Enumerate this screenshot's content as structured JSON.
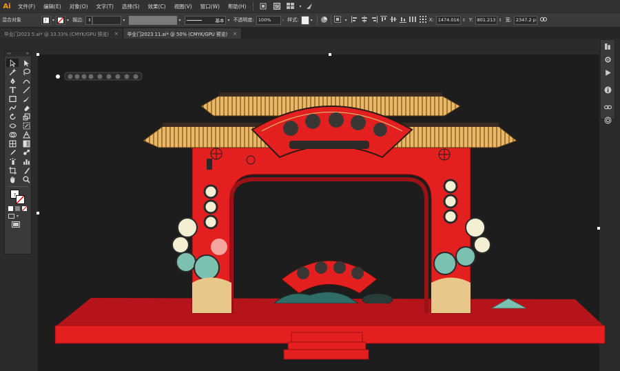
{
  "app": {
    "logo": "Ai"
  },
  "menu": [
    "文件(F)",
    "编辑(E)",
    "对象(O)",
    "文字(T)",
    "选择(S)",
    "效果(C)",
    "视图(V)",
    "窗口(W)",
    "帮助(H)"
  ],
  "control": {
    "selection_label": "混合对象",
    "stroke_label": "描边:",
    "stroke_style": "基本",
    "opacity_label": "不透明度:",
    "opacity_value": "100%",
    "style_label": "样式:",
    "x_label": "X:",
    "x_value": "1474.016",
    "y_label": "Y:",
    "y_value": "801.213",
    "w_label": "宽:",
    "w_value": "2347.2 p"
  },
  "tabs": [
    {
      "label": "毕业门2023 5.ai* @ 33.33% (CMYK/GPU 预览)",
      "active": false
    },
    {
      "label": "毕业门2023 11.ai* @ 50% (CMYK/GPU 预览)",
      "active": true
    }
  ],
  "tab_close": "×",
  "toolbar": {
    "collapse": "««",
    "close": "×",
    "tools": [
      "selection-tool",
      "direct-selection-tool",
      "magic-wand-tool",
      "lasso-tool",
      "pen-tool",
      "curvature-tool",
      "type-tool",
      "line-tool",
      "rectangle-tool",
      "paintbrush-tool",
      "shaper-tool",
      "eraser-tool",
      "rotate-tool",
      "scale-tool",
      "width-tool",
      "free-transform-tool",
      "shape-builder-tool",
      "perspective-grid-tool",
      "mesh-tool",
      "gradient-tool",
      "eyedropper-tool",
      "blend-tool",
      "symbol-sprayer-tool",
      "column-graph-tool",
      "artboard-tool",
      "slice-tool",
      "hand-tool",
      "zoom-tool"
    ]
  },
  "colors": {
    "red": "#e3201f",
    "dark_red": "#b5141a",
    "gold": "#e8b96a",
    "teal": "#7cc1b0",
    "cream": "#f3efd2",
    "artboard": "#1e1d1e"
  }
}
